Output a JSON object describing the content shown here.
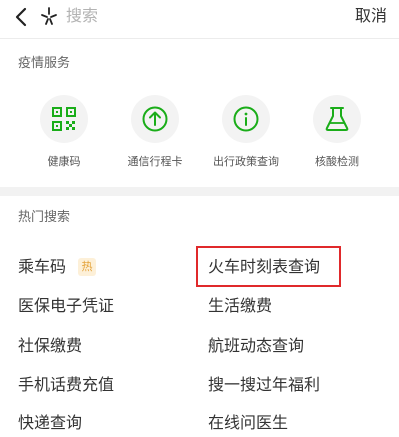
{
  "search": {
    "back_icon": "chevron-left-icon",
    "glyph_icon": "sparkle-icon",
    "placeholder": "搜索",
    "cancel_label": "取消"
  },
  "epidemic": {
    "title": "疫情服务",
    "items": [
      {
        "label": "健康码",
        "icon": "qr-code-icon"
      },
      {
        "label": "通信行程卡",
        "icon": "arrow-up-circle-icon"
      },
      {
        "label": "出行政策查询",
        "icon": "info-icon"
      },
      {
        "label": "核酸检测",
        "icon": "flask-icon"
      }
    ]
  },
  "hot_search": {
    "title": "热门搜索",
    "badge": "热",
    "left": [
      "乘车码",
      "医保电子凭证",
      "社保缴费",
      "手机话费充值",
      "快递查询"
    ],
    "right": [
      "火车时刻表查询",
      "生活缴费",
      "航班动态查询",
      "搜一搜过年福利",
      "在线问医生"
    ]
  },
  "colors": {
    "accent_green": "#1aad19",
    "highlight_red": "#e0292b",
    "badge_orange": "#e4a33a"
  }
}
